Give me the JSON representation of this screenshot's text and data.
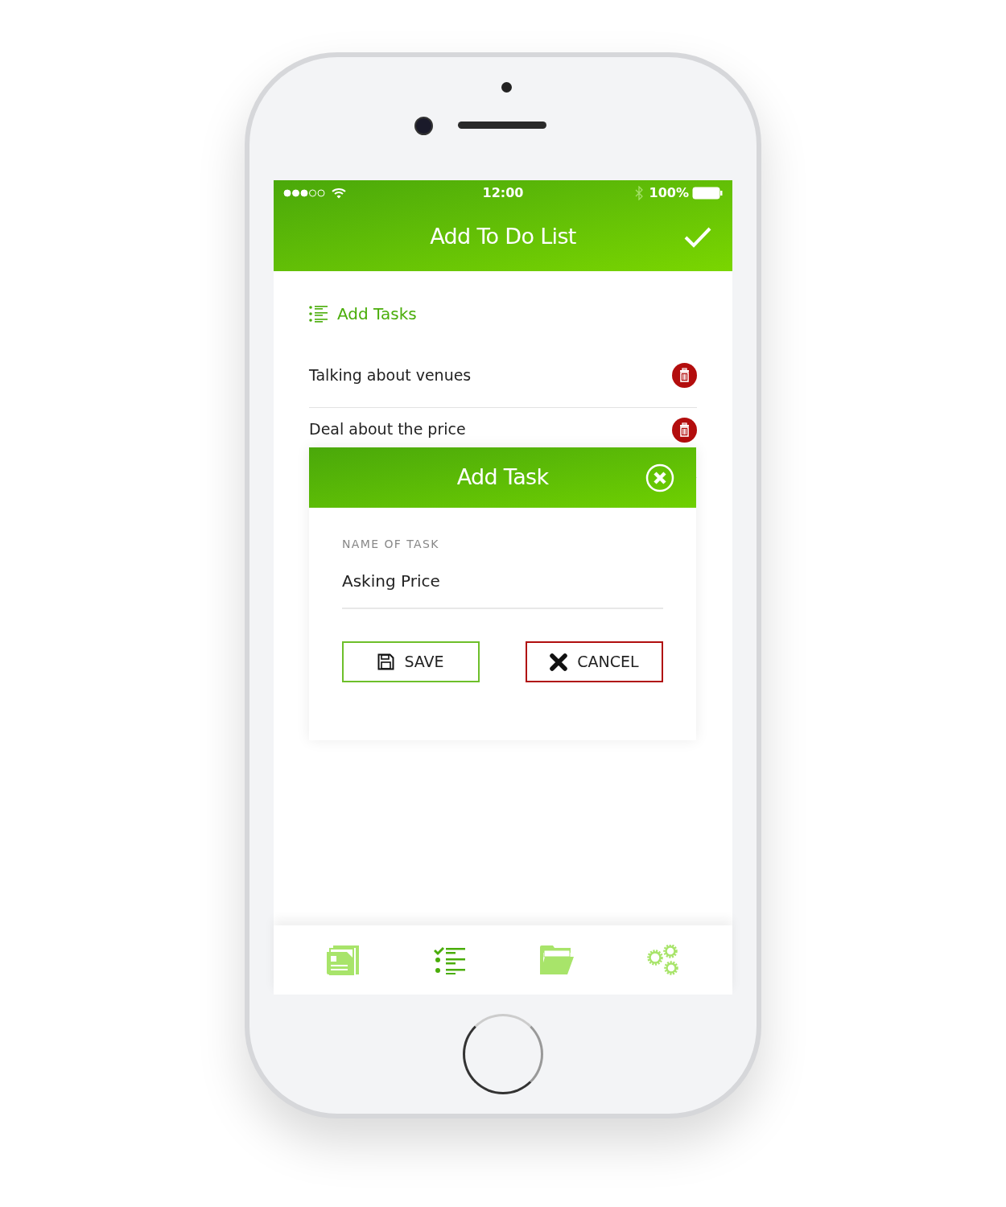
{
  "status_bar": {
    "time": "12:00",
    "battery": "100%"
  },
  "header": {
    "title": "Add To Do List"
  },
  "section": {
    "title": "Add Tasks"
  },
  "tasks": [
    {
      "name": "Talking about venues"
    },
    {
      "name": "Deal about the price"
    }
  ],
  "dialog": {
    "title": "Add Task",
    "field": {
      "label": "NAME OF TASK",
      "value": "Asking Price"
    },
    "buttons": [
      {
        "kind": "save",
        "label": "SAVE"
      },
      {
        "kind": "cancel",
        "label": "CANCEL"
      }
    ]
  },
  "tab_bar": [
    {
      "kind": "news",
      "selected": false
    },
    {
      "kind": "checklist",
      "selected": true
    },
    {
      "kind": "folder",
      "selected": false
    },
    {
      "kind": "settings",
      "selected": false
    }
  ]
}
